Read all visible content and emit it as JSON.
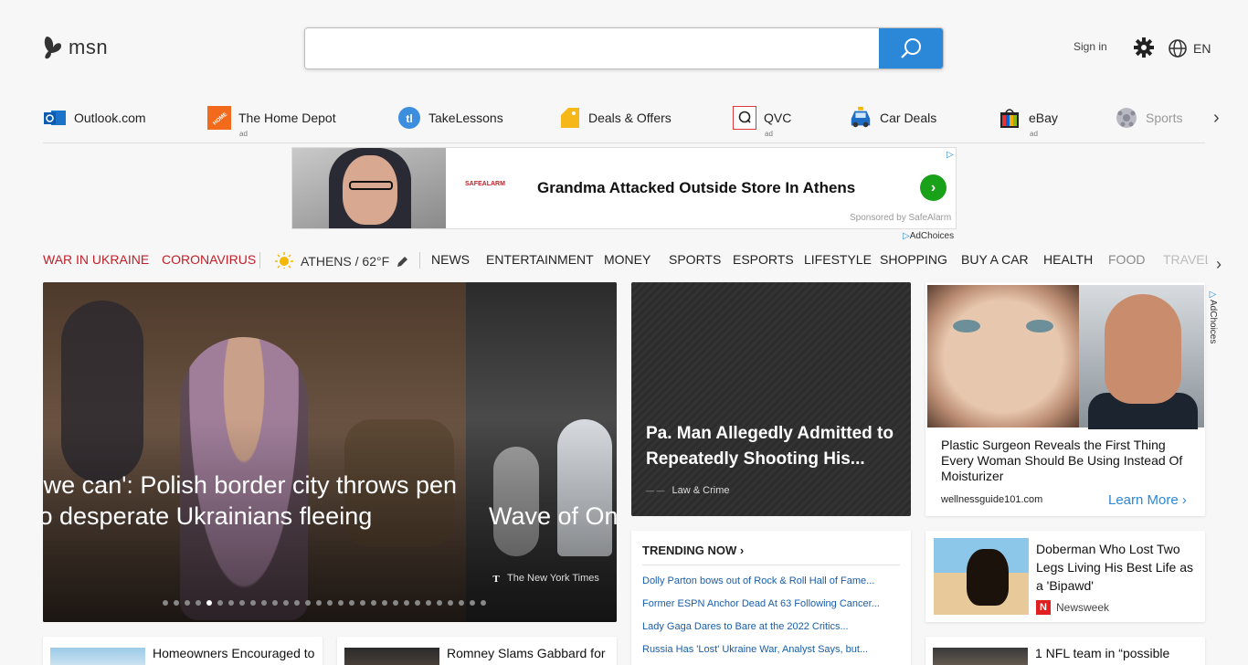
{
  "header": {
    "logo_text": "msn",
    "search_placeholder": "",
    "signin": "Sign in",
    "lang": "EN"
  },
  "quicklinks": [
    {
      "label": "Outlook.com",
      "ad": "",
      "icon": "outlook-icon"
    },
    {
      "label": "The Home Depot",
      "ad": "ad",
      "icon": "home-depot-icon"
    },
    {
      "label": "TakeLessons",
      "ad": "",
      "icon": "takelessons-icon"
    },
    {
      "label": "Deals & Offers",
      "ad": "",
      "icon": "tag-icon"
    },
    {
      "label": "QVC",
      "ad": "ad",
      "icon": "qvc-icon"
    },
    {
      "label": "Car Deals",
      "ad": "",
      "icon": "car-icon"
    },
    {
      "label": "eBay",
      "ad": "ad",
      "icon": "ebay-icon"
    },
    {
      "label": "Sports",
      "ad": "",
      "icon": "sports-icon"
    }
  ],
  "banner": {
    "logo": "SAFEALARM",
    "title": "Grandma Attacked Outside Store In Athens",
    "sponsor": "Sponsored by SafeAlarm",
    "adchoices": "AdChoices"
  },
  "nav": {
    "war": "WAR IN UKRAINE",
    "corona": "CORONAVIRUS",
    "weather": "ATHENS / 62°F",
    "items": [
      "NEWS",
      "ENTERTAINMENT",
      "MONEY",
      "SPORTS",
      "ESPORTS",
      "LIFESTYLE",
      "SHOPPING",
      "BUY A CAR",
      "HEALTH",
      "FOOD",
      "TRAVEL"
    ]
  },
  "hero": {
    "title1": "' we can': Polish border city throws pen to desperate Ukrainians fleeing",
    "title2": "Wave of On Lockdowns",
    "source2": "The New York Times",
    "dots": 30,
    "active_dot": 4
  },
  "midcard": {
    "title": "Pa. Man Allegedly Admitted to Repeatedly Shooting His...",
    "source": "Law & Crime"
  },
  "trending": {
    "heading": "TRENDING NOW",
    "items": [
      "Dolly Parton bows out of Rock & Roll Hall of Fame...",
      "Former ESPN Anchor Dead At 63 Following Cancer...",
      "Lady Gaga Dares to Bare at the 2022 Critics...",
      "Russia Has 'Lost' Ukraine War, Analyst Says, but..."
    ]
  },
  "rightad": {
    "text": "Plastic Surgeon Reveals the First Thing Every Woman Should Be Using Instead Of Moisturizer",
    "site": "wellnessguide101.com",
    "learn": "Learn More",
    "adchoices": "AdChoices"
  },
  "dobcard": {
    "title": "Doberman Who Lost Two Legs Living His Best Life as a 'Bipawd'",
    "source": "Newsweek"
  },
  "bottom": [
    {
      "title": "Homeowners Encouraged to"
    },
    {
      "title": "Romney Slams Gabbard for"
    },
    {
      "title": "1 NFL team in “possible"
    }
  ],
  "colors": {
    "accent": "#2b88d8",
    "nav_red": "#c0202a",
    "link": "#1a5ea8"
  }
}
